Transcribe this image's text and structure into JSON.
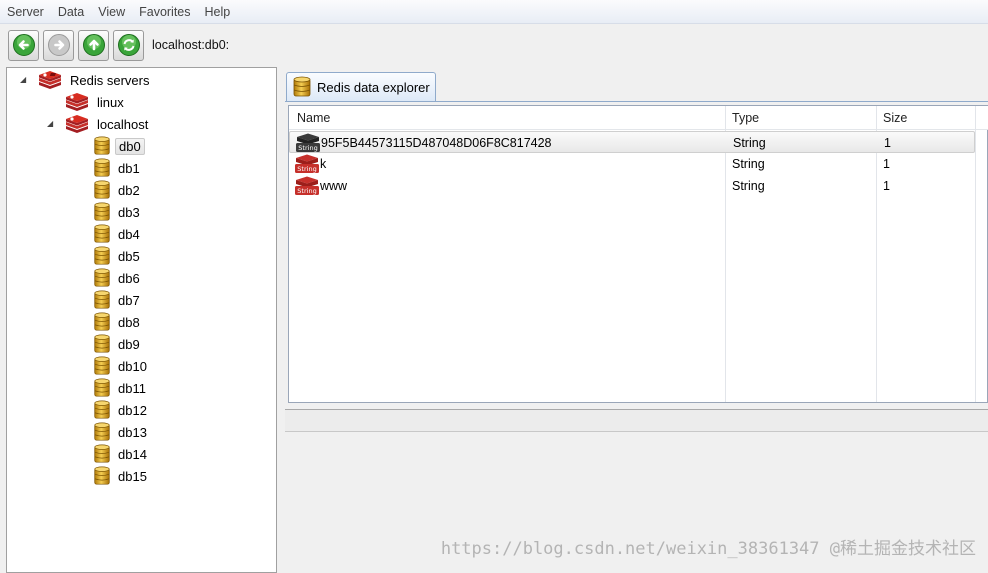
{
  "menu": [
    "Server",
    "Data",
    "View",
    "Favorites",
    "Help"
  ],
  "toolbar": {
    "address": "localhost:db0:"
  },
  "tree": {
    "root": "Redis servers",
    "servers": [
      {
        "label": "linux"
      },
      {
        "label": "localhost"
      }
    ],
    "databases": [
      "db0",
      "db1",
      "db2",
      "db3",
      "db4",
      "db5",
      "db6",
      "db7",
      "db8",
      "db9",
      "db10",
      "db11",
      "db12",
      "db13",
      "db14",
      "db15"
    ],
    "selected": "db0"
  },
  "explorer": {
    "tab_label": "Redis data explorer",
    "columns": [
      "Name",
      "Type",
      "Size"
    ],
    "rows": [
      {
        "name": "95F5B44573115D487048D06F8C817428",
        "type": "String",
        "size": "1",
        "icon": "string-key-dark-icon"
      },
      {
        "name": "k",
        "type": "String",
        "size": "1",
        "icon": "string-key-red-icon"
      },
      {
        "name": "www",
        "type": "String",
        "size": "1",
        "icon": "string-key-red-icon"
      }
    ],
    "icon_text": "String"
  },
  "watermark": "https://blog.csdn.net/weixin_38361347 @稀土掘金技术社区",
  "colors": {
    "redis_red": "#c6302b",
    "db_gold": "#d4a017",
    "selection_border": "#c9c9c9",
    "tab_border": "#8faacb"
  }
}
